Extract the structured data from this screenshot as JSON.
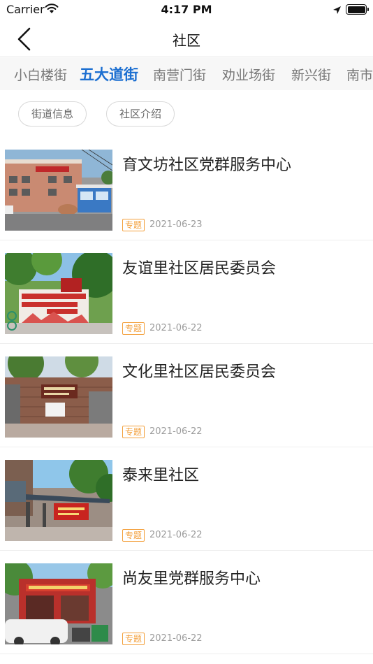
{
  "status_bar": {
    "carrier": "Carrier",
    "time": "4:17 PM"
  },
  "nav": {
    "title": "社区"
  },
  "tabs": [
    {
      "label": "小白楼街"
    },
    {
      "label": "五大道街",
      "active": true
    },
    {
      "label": "南营门街"
    },
    {
      "label": "劝业场街"
    },
    {
      "label": "新兴街"
    },
    {
      "label": "南市"
    }
  ],
  "chips": [
    {
      "label": "街道信息"
    },
    {
      "label": "社区介绍"
    }
  ],
  "items": [
    {
      "title": "育文坊社区党群服务中心",
      "tag": "专题",
      "date": "2021-06-23"
    },
    {
      "title": "友谊里社区居民委员会",
      "tag": "专题",
      "date": "2021-06-22"
    },
    {
      "title": "文化里社区居民委员会",
      "tag": "专题",
      "date": "2021-06-22"
    },
    {
      "title": "泰来里社区",
      "tag": "专题",
      "date": "2021-06-22"
    },
    {
      "title": "尚友里党群服务中心",
      "tag": "专题",
      "date": "2021-06-22"
    }
  ],
  "colors": {
    "accent": "#1c6fd1",
    "tag": "#f3a03c",
    "date": "#9b9b9b"
  }
}
